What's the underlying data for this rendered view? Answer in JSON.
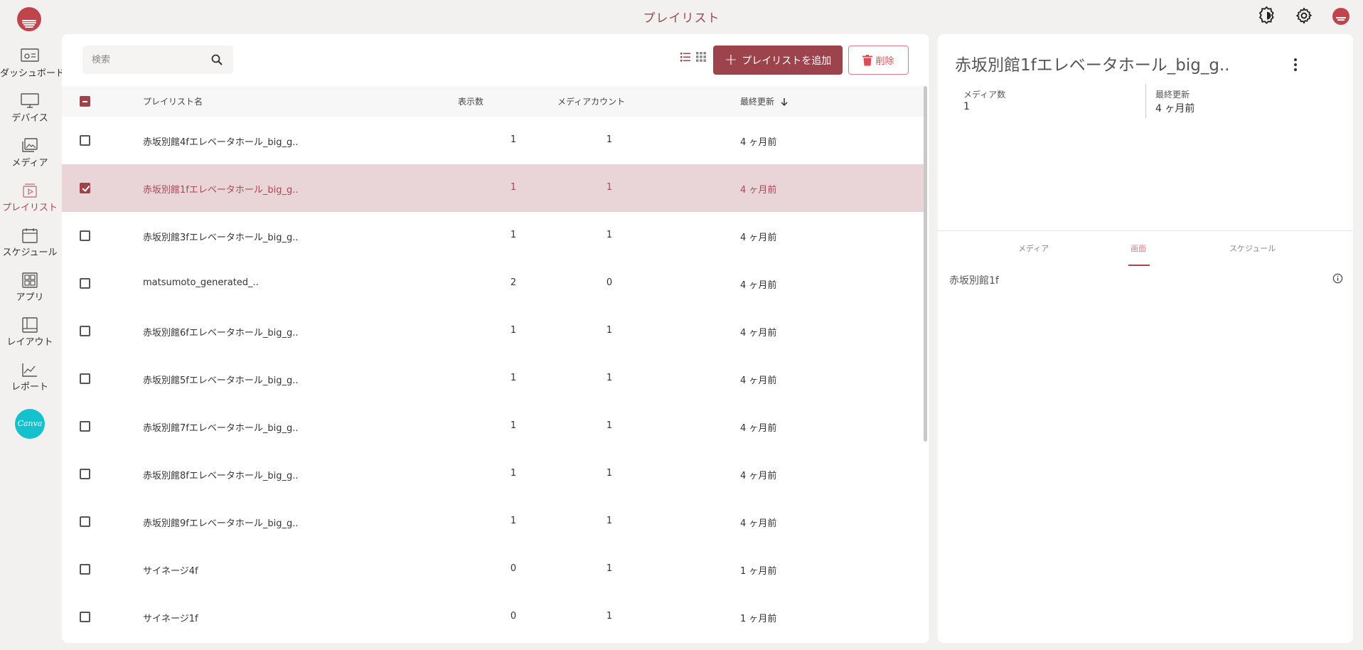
{
  "header": {
    "title": "プレイリスト"
  },
  "sidebar": {
    "items": [
      {
        "label": "ダッシュボード",
        "icon": "dashboard-icon",
        "active": false
      },
      {
        "label": "デバイス",
        "icon": "monitor-icon",
        "active": false
      },
      {
        "label": "メディア",
        "icon": "media-icon",
        "active": false
      },
      {
        "label": "プレイリスト",
        "icon": "playlist-icon",
        "active": true
      },
      {
        "label": "スケジュール",
        "icon": "calendar-icon",
        "active": false
      },
      {
        "label": "アプリ",
        "icon": "apps-icon",
        "active": false
      },
      {
        "label": "レイアウト",
        "icon": "layout-icon",
        "active": false
      },
      {
        "label": "レポート",
        "icon": "report-icon",
        "active": false
      }
    ],
    "canva_label": "Canva"
  },
  "toolbar": {
    "search_placeholder": "検索",
    "add_label": "プレイリストを追加",
    "delete_label": "削除"
  },
  "table": {
    "headers": {
      "name": "プレイリスト名",
      "display_count": "表示数",
      "media_count": "メディアカウント",
      "updated": "最終更新"
    },
    "rows": [
      {
        "name": "赤坂別館4fエレベータホール_big_g..",
        "display": "1",
        "media": "1",
        "updated": "4 ヶ月前",
        "selected": false
      },
      {
        "name": "赤坂別館1fエレベータホール_big_g..",
        "display": "1",
        "media": "1",
        "updated": "4 ヶ月前",
        "selected": true
      },
      {
        "name": "赤坂別館3fエレベータホール_big_g..",
        "display": "1",
        "media": "1",
        "updated": "4 ヶ月前",
        "selected": false
      },
      {
        "name": "matsumoto_generated_..",
        "display": "2",
        "media": "0",
        "updated": "4 ヶ月前",
        "selected": false
      },
      {
        "name": "赤坂別館6fエレベータホール_big_g..",
        "display": "1",
        "media": "1",
        "updated": "4 ヶ月前",
        "selected": false
      },
      {
        "name": "赤坂別館5fエレベータホール_big_g..",
        "display": "1",
        "media": "1",
        "updated": "4 ヶ月前",
        "selected": false
      },
      {
        "name": "赤坂別館7fエレベータホール_big_g..",
        "display": "1",
        "media": "1",
        "updated": "4 ヶ月前",
        "selected": false
      },
      {
        "name": "赤坂別館8fエレベータホール_big_g..",
        "display": "1",
        "media": "1",
        "updated": "4 ヶ月前",
        "selected": false
      },
      {
        "name": "赤坂別館9fエレベータホール_big_g..",
        "display": "1",
        "media": "1",
        "updated": "4 ヶ月前",
        "selected": false
      },
      {
        "name": "サイネージ4f",
        "display": "0",
        "media": "1",
        "updated": "1 ヶ月前",
        "selected": false
      },
      {
        "name": "サイネージ1f",
        "display": "0",
        "media": "1",
        "updated": "1 ヶ月前",
        "selected": false
      }
    ]
  },
  "detail": {
    "title": "赤坂別館1fエレベータホール_big_g..",
    "media_count_label": "メディア数",
    "media_count_value": "1",
    "updated_label": "最終更新",
    "updated_value": "4 ヶ月前",
    "tabs": [
      "メディア",
      "画面",
      "スケジュール"
    ],
    "active_tab": "画面",
    "screens": [
      "赤坂別館1f"
    ]
  },
  "colors": {
    "accent": "#9c434c",
    "accent_text": "#b0444e",
    "selected_row": "#e9d5d8",
    "delete": "#e04a52",
    "canva": "#14c1cc"
  }
}
